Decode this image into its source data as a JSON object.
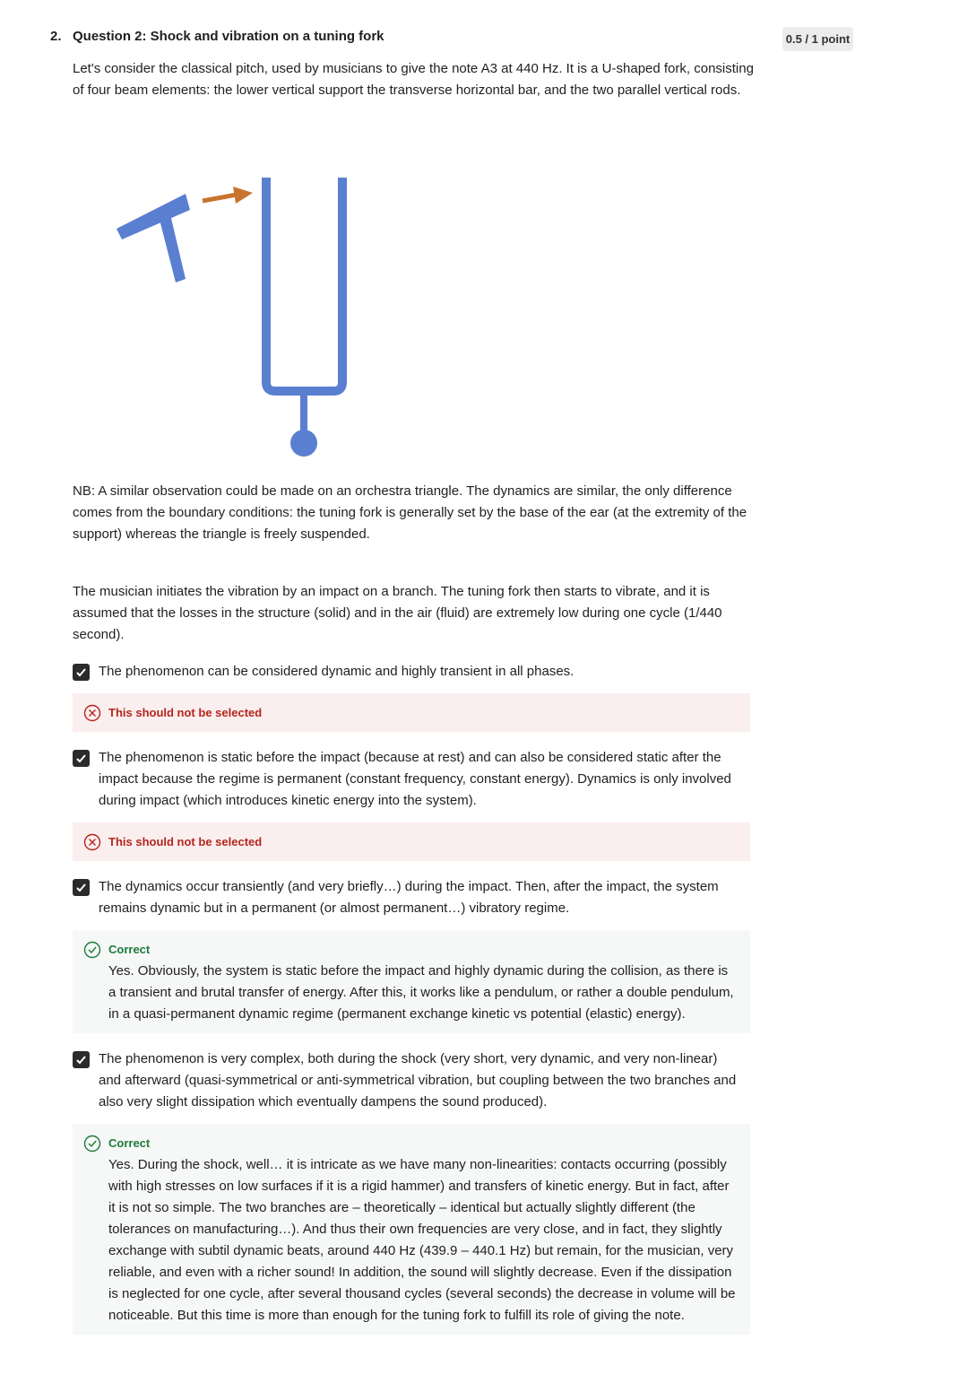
{
  "question": {
    "number": "2.",
    "title": "Question 2: Shock and vibration on a tuning fork",
    "score": "0.5 / 1 point",
    "intro": "Let's consider the classical pitch, used by musicians to give the note A3 at 440 Hz. It is a U-shaped fork, consisting of four beam elements: the lower vertical support the transverse horizontal bar, and the two parallel vertical rods.",
    "nb": "NB: A similar observation could be made on an orchestra triangle. The dynamics are similar, the only difference comes from the boundary conditions: the tuning fork is generally set by the base of the ear (at the extremity of the support) whereas the triangle is freely suspended.",
    "musician": "The musician initiates the vibration by an impact on a branch. The tuning fork then starts to vibrate, and it is assumed that the losses in the structure (solid) and in the air (fluid) are extremely low during one cycle (1/440 second)."
  },
  "figure": {
    "hammer_color": "#5a7fd1",
    "arrow_color": "#c8742e",
    "fork_color": "#5a7fd1"
  },
  "options": [
    {
      "text": "The phenomenon can be considered dynamic and highly transient in all phases.",
      "checked": true,
      "feedback_label": "This should not be selected"
    },
    {
      "text": "The phenomenon is static before the impact (because at rest) and can also be considered static after the impact because the regime is permanent (constant frequency, constant energy). Dynamics is only involved during impact (which introduces kinetic energy into the system).",
      "checked": true,
      "feedback_label": "This should not be selected"
    },
    {
      "text": "The dynamics occur transiently (and very briefly…) during the impact. Then, after the impact, the system remains dynamic but in a permanent (or almost permanent…) vibratory regime.",
      "checked": true,
      "feedback_label": "Correct",
      "feedback_text": "Yes. Obviously, the system is static before the impact and highly dynamic during the collision, as there is a transient and brutal transfer of energy. After this, it works like a pendulum, or rather a double pendulum, in a quasi-permanent dynamic regime (permanent exchange kinetic vs potential (elastic) energy)."
    },
    {
      "text": "The phenomenon is very complex, both during the shock (very short, very dynamic, and very non-linear) and afterward (quasi-symmetrical or anti-symmetrical vibration, but coupling between the two branches and also very slight dissipation which eventually dampens the sound produced).",
      "checked": true,
      "feedback_label": "Correct",
      "feedback_text": "Yes. During the shock, well… it is intricate as we have many non-linearities: contacts occurring (possibly with high stresses on low surfaces if it is a rigid hammer) and transfers of kinetic energy. But in fact, after it is not so simple. The two branches are – theoretically – identical but actually slightly different (the tolerances on manufacturing…). And thus their own frequencies are very close, and in fact, they slightly exchange with subtil dynamic beats, around 440 Hz (439.9 – 440.1 Hz) but remain, for the musician, very reliable, and even with a richer sound! In addition, the sound will slightly decrease. Even if the dissipation is neglected for one cycle, after several thousand cycles (several seconds) the decrease in volume will be noticeable. But this time is more than enough for the tuning fork to fulfill its role of giving the note."
    }
  ]
}
